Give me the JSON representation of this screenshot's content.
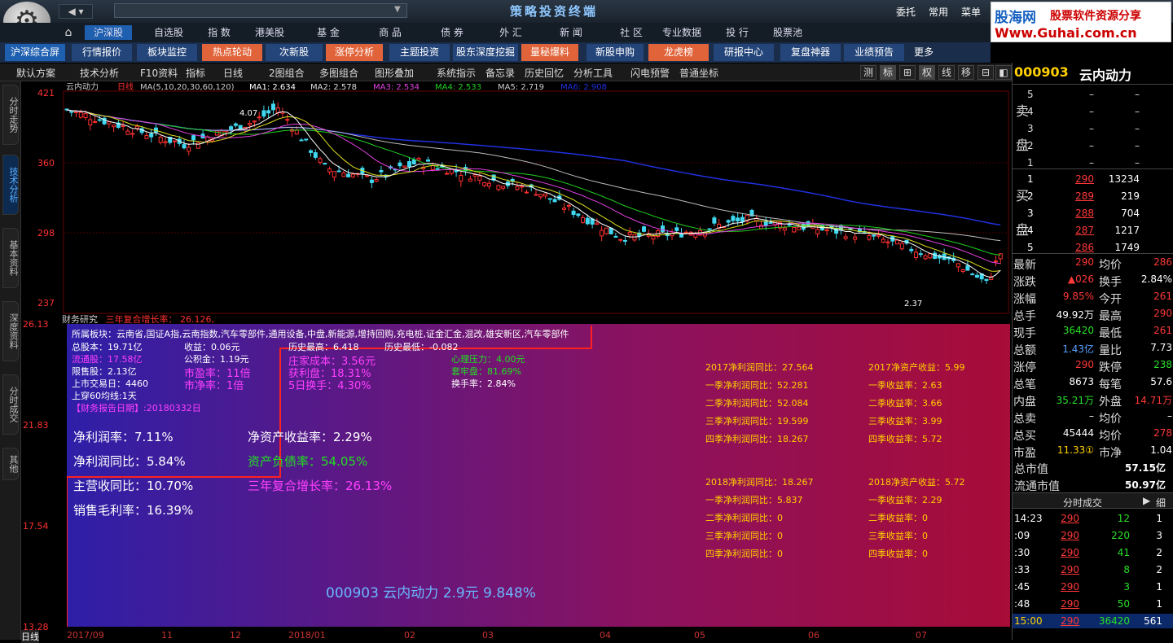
{
  "app": {
    "title": "策略投资终端",
    "top_right": [
      "委托",
      "常用",
      "菜单"
    ],
    "ad_line1": "股海网",
    "ad_line2": "股票软件资源分享",
    "ad_line3": "Www.Guhai.com.cn"
  },
  "nav1": [
    "沪深股",
    "自选股",
    "指 数",
    "港美股",
    "基 金",
    "商 品",
    "债 券",
    "外 汇",
    "新 闻",
    "社 区",
    "专业数据",
    "投 行",
    "股票池"
  ],
  "nav2": [
    "沪深综合屏",
    "行情报价",
    "板块监控",
    "热点轮动",
    "次新股",
    "涨停分析",
    "主题投资",
    "股东深度挖掘",
    "量秘爆料",
    "新股申购",
    "龙虎榜",
    "研报中心",
    "复盘神器",
    "业绩预告",
    "更多"
  ],
  "toolbar": {
    "items": [
      "默认方案",
      "技术分析",
      "F10资料",
      "指标",
      "日线",
      "2图组合",
      "多图组合",
      "图形叠加",
      "系统指示",
      "备忘录",
      "历史回忆",
      "分析工具",
      "闪电预警",
      "普通坐标"
    ],
    "right": [
      "测",
      "标",
      "⊞",
      "权",
      "线",
      "移",
      "⊟",
      "◧"
    ]
  },
  "left_tabs": [
    "分时走势",
    "技术分析",
    "基本资料",
    "深度资料",
    "分时成交",
    "其他"
  ],
  "chart_header": {
    "name": "云内动力",
    "period": "日线",
    "ma": "MA(5,10,20,30,60,120)",
    "ma1": "MA1: 2.634",
    "ma2": "MA2: 2.578",
    "ma3": "MA3: 2.534",
    "ma4": "MA4: 2.533",
    "ma5": "MA5: 2.719",
    "ma6": "MA6: 2.908",
    "hi_label": "4.07",
    "lo_label": "2.37"
  },
  "price_axis": [
    "421",
    "360",
    "298",
    "237"
  ],
  "sub_header": {
    "a": "财务研究",
    "b": "三年复合增长率：",
    "c": "26.126,"
  },
  "low_axis": [
    "26.13",
    "21.83",
    "17.54",
    "13.28"
  ],
  "x_axis": [
    "日线",
    "2017/09",
    "11",
    "12",
    "2018/01",
    "02",
    "03",
    "04",
    "05",
    "06",
    "07"
  ],
  "fin": {
    "sectors": "所属板块：云南省,国证A指,云南指数,汽车零部件,通用设备,中盘,新能源,增持回购,充电桩,证金汇金,混改,雄安新区,汽车零部件",
    "c1": [
      "总股本：19.71亿",
      "流通股：17.58亿",
      "限售股：2.13亿",
      "上市交易日：4460",
      "上穿60均线:1天",
      "【财务报告日期】:20180332日"
    ],
    "c2": [
      "收益：0.06元",
      "公积金：1.19元",
      "市盈率：11倍",
      "市净率：1倍"
    ],
    "c3": [
      "历史最高：6.418",
      "庄家成本：3.56元",
      "获利盘：18.31%",
      "5日换手：4.30%"
    ],
    "c3b": "历史最低：-0.082",
    "c4": [
      "心理压力：4.00元",
      "套牢盘：81.69%",
      "换手率：2.84%"
    ],
    "big1": [
      "净利润率：7.11%",
      "净利润同比：5.84%",
      "主营收同比：10.70%",
      "销售毛利率：16.39%"
    ],
    "big2": [
      "净资产收益率：2.29%",
      "资产负债率：54.05%",
      "三年复合增长率：26.13%"
    ],
    "r1": [
      "2017净利润同比：27.564",
      "一季净利润同比：52.281",
      "二季净利润同比：52.084",
      "三季净利润同比：19.599",
      "四季净利润同比：18.267"
    ],
    "r2": [
      "2017净资产收益：5.99",
      "一季收益率：2.63",
      "二季收益率：3.66",
      "三季收益率：3.99",
      "四季收益率：5.72"
    ],
    "r3": [
      "2018净利润同比：18.267",
      "一季净利润同比：5.837",
      "二季净利润同比：0",
      "三季净利润同比：0",
      "四季净利润同比：0"
    ],
    "r4": [
      "2018净资产收益：5.72",
      "一季收益率：2.29",
      "二季收益率：0",
      "三季收益率：0",
      "四季收益率：0"
    ],
    "summary": "000903 云内动力 2.9元 9.848%"
  },
  "quote": {
    "code": "000903",
    "name": "云内动力",
    "sell_label": [
      "卖",
      "盘"
    ],
    "buy_label": [
      "买",
      "盘"
    ],
    "sell": [
      [
        "5",
        "–",
        "–"
      ],
      [
        "4",
        "–",
        "–"
      ],
      [
        "3",
        "–",
        "–"
      ],
      [
        "2",
        "–",
        "–"
      ],
      [
        "1",
        "–",
        "–"
      ]
    ],
    "buy": [
      [
        "1",
        "290",
        "13234"
      ],
      [
        "2",
        "289",
        "219"
      ],
      [
        "3",
        "288",
        "704"
      ],
      [
        "4",
        "287",
        "1217"
      ],
      [
        "5",
        "286",
        "1749"
      ]
    ],
    "stats": [
      [
        "最新",
        "290",
        "均价",
        "286"
      ],
      [
        "涨跌",
        "▲026",
        "换手",
        "2.84%"
      ],
      [
        "涨幅",
        "9.85%",
        "今开",
        "261"
      ],
      [
        "总手",
        "49.92万",
        "最高",
        "290"
      ],
      [
        "现手",
        "36420",
        "最低",
        "261"
      ],
      [
        "总额",
        "1.43亿",
        "量比",
        "7.73"
      ],
      [
        "涨停",
        "290",
        "跌停",
        "238"
      ],
      [
        "总笔",
        "8673",
        "每笔",
        "57.6"
      ],
      [
        "内盘",
        "35.21万",
        "外盘",
        "14.71万"
      ],
      [
        "总卖",
        "–",
        "均价",
        "–"
      ],
      [
        "总买",
        "45444",
        "均价",
        "278"
      ],
      [
        "市盈",
        "11.33①",
        "市净",
        "1.04"
      ]
    ],
    "total_mv_label": "总市值",
    "total_mv": "57.15亿",
    "float_mv_label": "流通市值",
    "float_mv": "50.97亿",
    "trade_tab": "分时成交",
    "trade_tab2": "细",
    "trades": [
      [
        "14:23",
        "290",
        "12",
        "1"
      ],
      [
        ":09",
        "290",
        "220",
        "3"
      ],
      [
        ":30",
        "290",
        "41",
        "2"
      ],
      [
        ":33",
        "290",
        "8",
        "2"
      ],
      [
        ":45",
        "290",
        "3",
        "1"
      ],
      [
        ":48",
        "290",
        "50",
        "1"
      ],
      [
        "15:00",
        "290",
        "36420",
        "561"
      ]
    ]
  }
}
